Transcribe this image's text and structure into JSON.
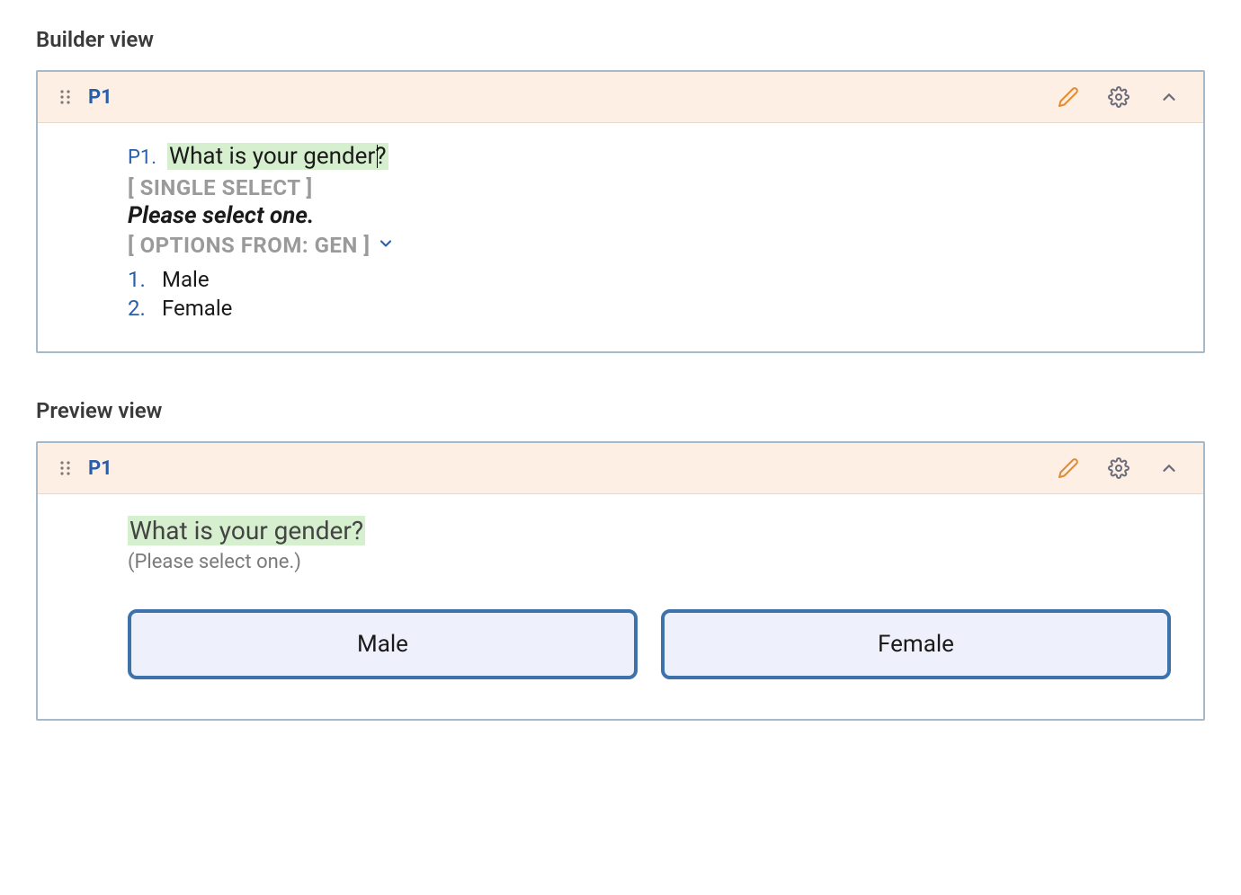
{
  "builder": {
    "section_title": "Builder view",
    "header": {
      "id": "P1"
    },
    "question": {
      "prefix": "P1.",
      "text": "What is your gender?",
      "type_label": "[ SINGLE SELECT ]",
      "instruction": "Please select one.",
      "options_from": "[ OPTIONS FROM: GEN ]",
      "options": [
        {
          "num": "1.",
          "text": "Male"
        },
        {
          "num": "2.",
          "text": "Female"
        }
      ]
    }
  },
  "preview": {
    "section_title": "Preview view",
    "header": {
      "id": "P1"
    },
    "question_text": "What is your gender?",
    "instruction": "(Please select one.)",
    "options": [
      {
        "label": "Male"
      },
      {
        "label": "Female"
      }
    ]
  }
}
